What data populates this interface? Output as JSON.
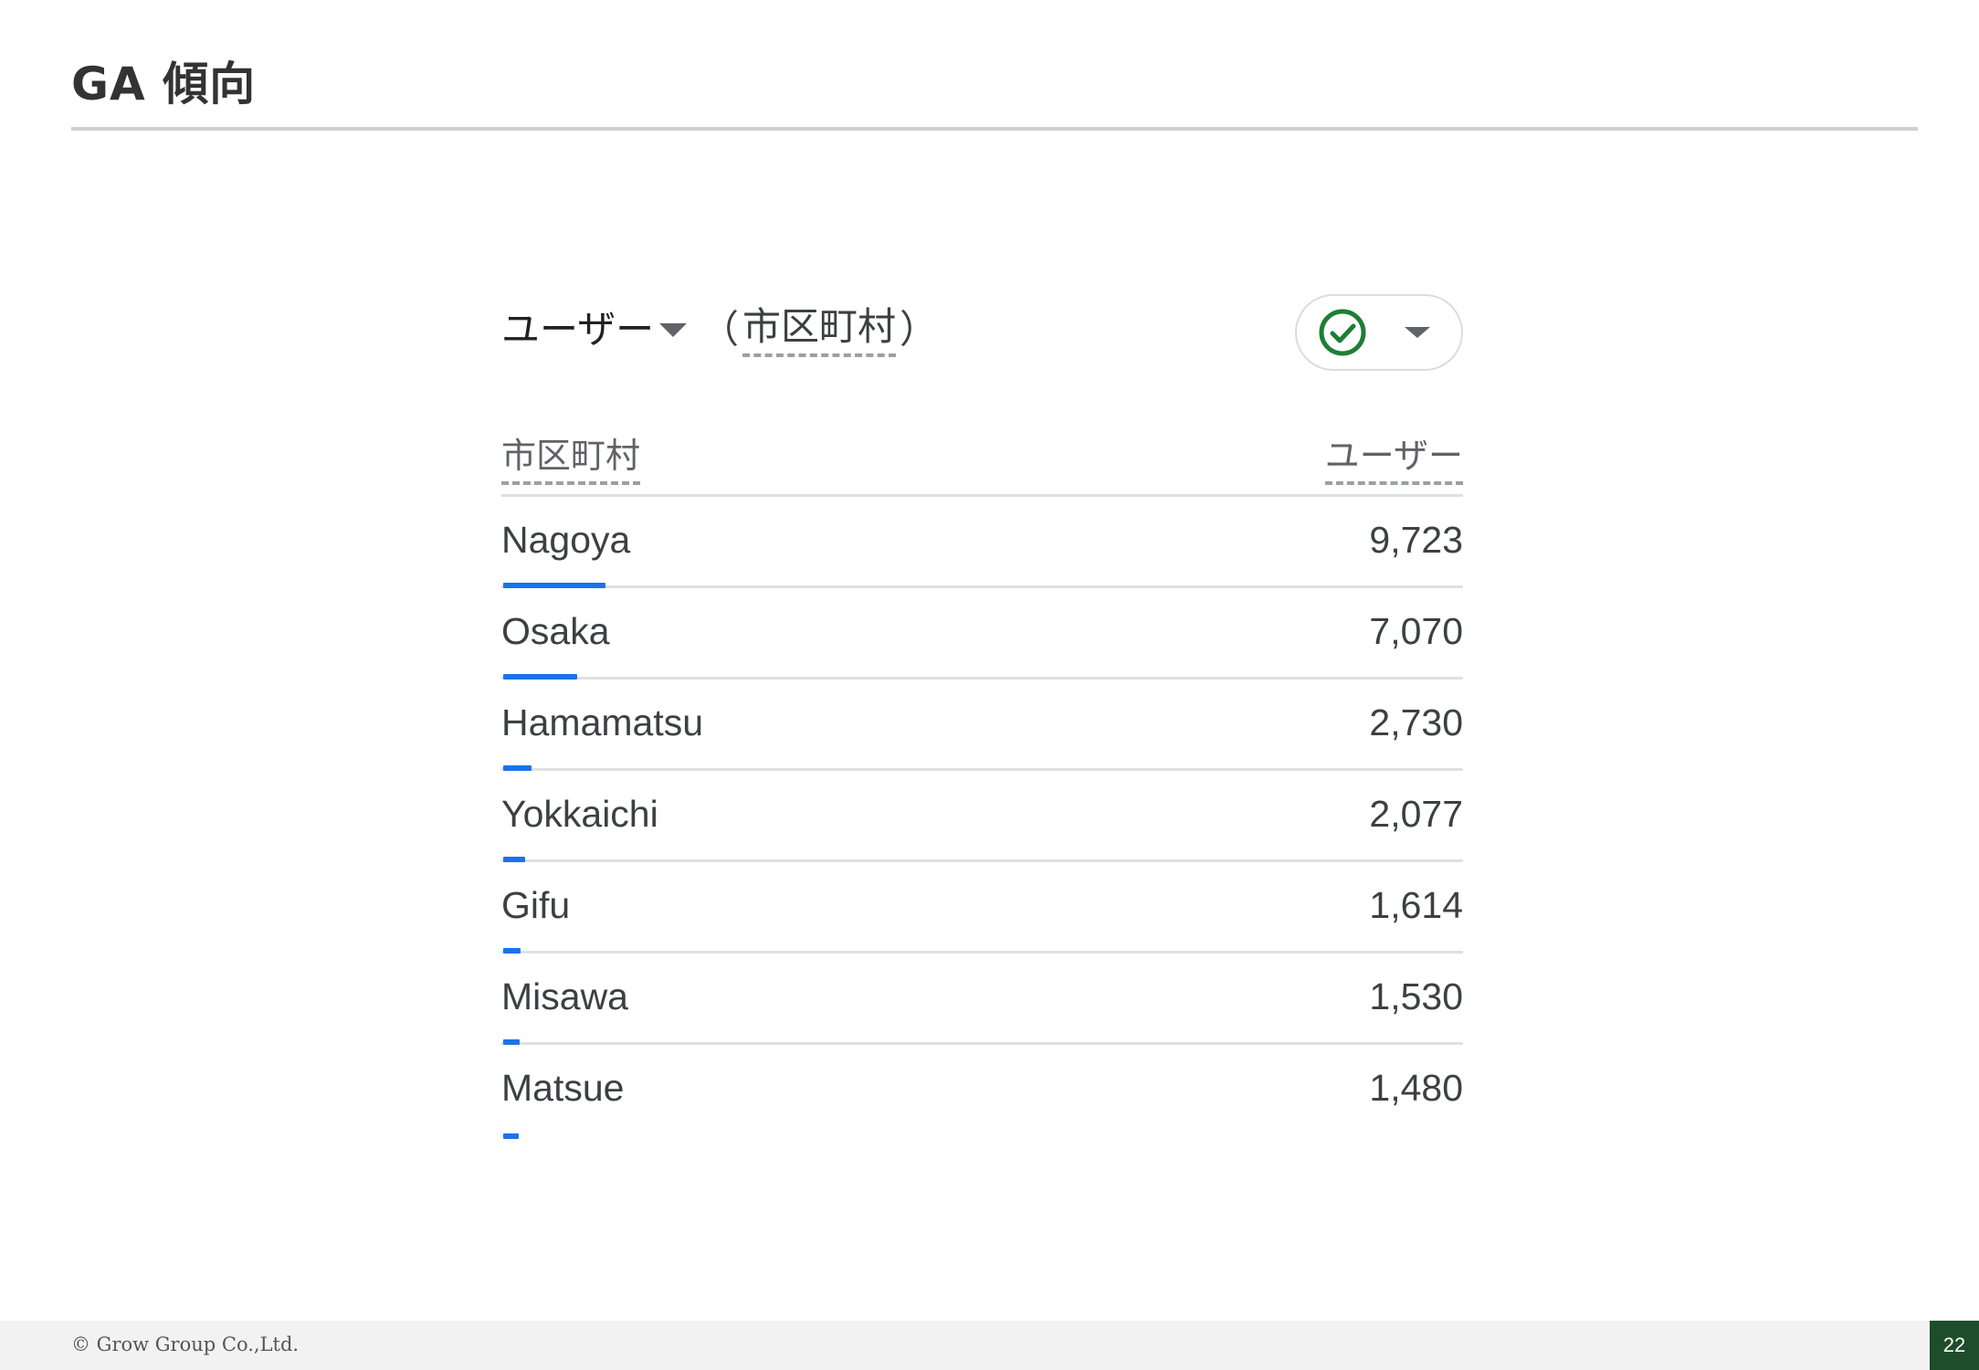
{
  "slide": {
    "title": "GA 傾向",
    "page_number": "22",
    "copyright": "© Grow Group Co.,Ltd."
  },
  "card": {
    "metric_label": "ユーザー",
    "dimension_open": "（",
    "dimension_label": "市区町村",
    "dimension_close": "）",
    "compare_icon": "check-circle-icon",
    "compare_icon_color": "#1e7e34"
  },
  "table": {
    "headers": {
      "dimension": "市区町村",
      "metric": "ユーザー"
    },
    "max_value": 9723,
    "bar_color": "#1a73e8",
    "rows": [
      {
        "city": "Nagoya",
        "users": "9,723",
        "value": 9723
      },
      {
        "city": "Osaka",
        "users": "7,070",
        "value": 7070
      },
      {
        "city": "Hamamatsu",
        "users": "2,730",
        "value": 2730
      },
      {
        "city": "Yokkaichi",
        "users": "2,077",
        "value": 2077
      },
      {
        "city": "Gifu",
        "users": "1,614",
        "value": 1614
      },
      {
        "city": "Misawa",
        "users": "1,530",
        "value": 1530
      },
      {
        "city": "Matsue",
        "users": "1,480",
        "value": 1480
      }
    ]
  }
}
